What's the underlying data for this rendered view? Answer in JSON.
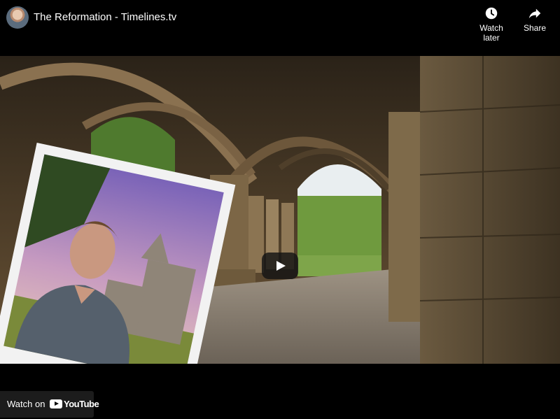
{
  "header": {
    "title": "The Reformation - Timelines.tv",
    "watch_later_label": "Watch later",
    "share_label": "Share"
  },
  "footer": {
    "watch_on_label": "Watch on",
    "youtube_wordmark": "YouTube"
  },
  "icons": {
    "watch_later": "clock-icon",
    "share": "share-arrow-icon",
    "play": "play-icon",
    "youtube": "youtube-logo-icon"
  },
  "colors": {
    "background": "#000000",
    "text": "#ffffff",
    "play_button": "#141414",
    "watch_on_bg": "#1c1c1c"
  }
}
